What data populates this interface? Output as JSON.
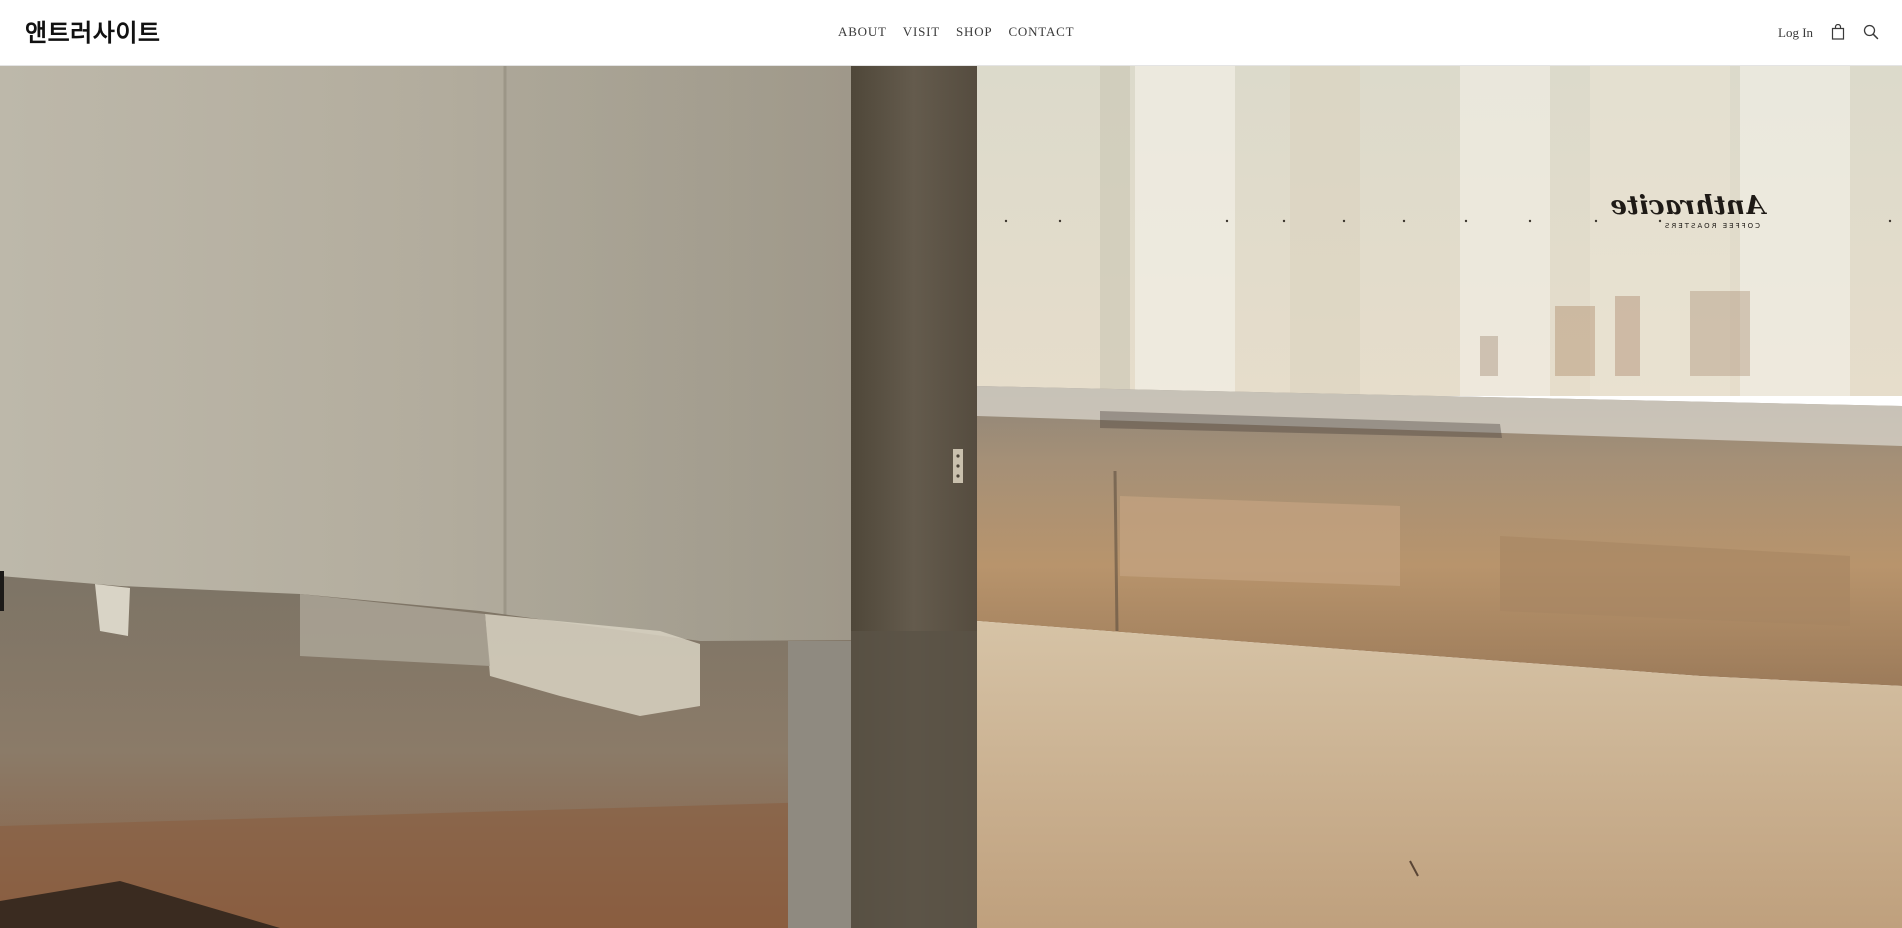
{
  "brand": {
    "logo_text": "앤트러사이트"
  },
  "nav": {
    "items": [
      {
        "label": "ABOUT"
      },
      {
        "label": "VISIT"
      },
      {
        "label": "SHOP"
      },
      {
        "label": "CONTACT"
      }
    ]
  },
  "account": {
    "login_label": "Log In"
  },
  "icons": {
    "cart": "shopping-bag-icon",
    "search": "magnifier-icon"
  },
  "hero": {
    "window_sign": {
      "title": "Anthracite",
      "subtitle": "COFFEE ROASTERS",
      "mirrored": true
    }
  },
  "colors": {
    "header_bg": "#ffffff",
    "nav_text": "#3a3a3a",
    "logo_text": "#111111",
    "wall_light": "#b7b2a4",
    "pillar_dark": "#5b5347",
    "floor": "#c9ae8c"
  }
}
